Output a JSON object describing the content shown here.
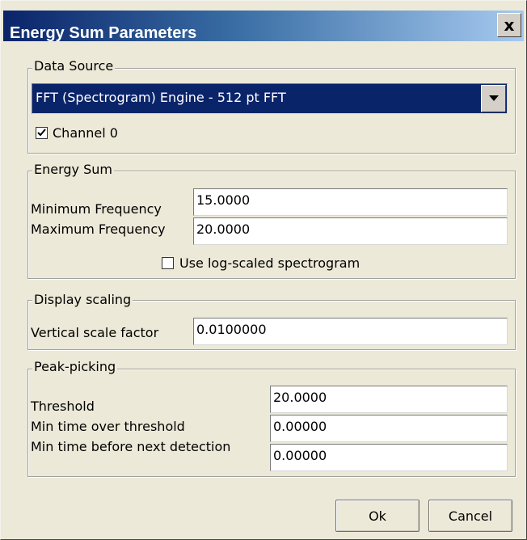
{
  "window": {
    "title": "Energy Sum Parameters",
    "close_glyph": "x"
  },
  "data_source": {
    "legend": "Data Source",
    "selected": "FFT (Spectrogram) Engine - 512 pt FFT",
    "channel_label": "Channel 0",
    "channel_checked": true
  },
  "energy_sum": {
    "legend": "Energy Sum",
    "min_freq_label": "Minimum Frequency",
    "min_freq_value": "15.0000",
    "max_freq_label": "Maximum Frequency",
    "max_freq_value": "20.0000",
    "log_label": "Use log-scaled spectrogram",
    "log_checked": false
  },
  "display_scaling": {
    "legend": "Display scaling",
    "vscale_label": "Vertical scale factor",
    "vscale_value": "0.0100000"
  },
  "peak_picking": {
    "legend": "Peak-picking",
    "threshold_label": "Threshold",
    "threshold_value": "20.0000",
    "min_over_label": "Min time over threshold",
    "min_over_value": "0.00000",
    "min_before_label": "Min time before next detection",
    "min_before_value": "0.00000"
  },
  "buttons": {
    "ok": "Ok",
    "cancel": "Cancel"
  }
}
